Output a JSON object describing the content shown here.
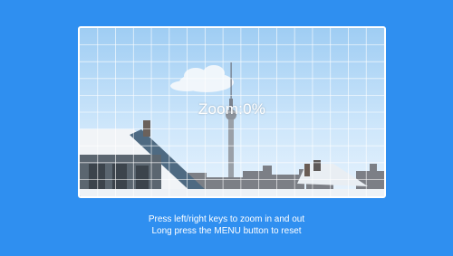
{
  "zoom": {
    "label": "Zoom:",
    "value": "0%"
  },
  "instructions": {
    "line1": "Press left/right keys to zoom in and out",
    "line2": "Long press the MENU button to reset"
  },
  "colors": {
    "background": "#2f8ff0",
    "frame": "#ffffff",
    "grid": "#ffffff"
  },
  "grid": {
    "columns": 17,
    "rows": 10
  }
}
